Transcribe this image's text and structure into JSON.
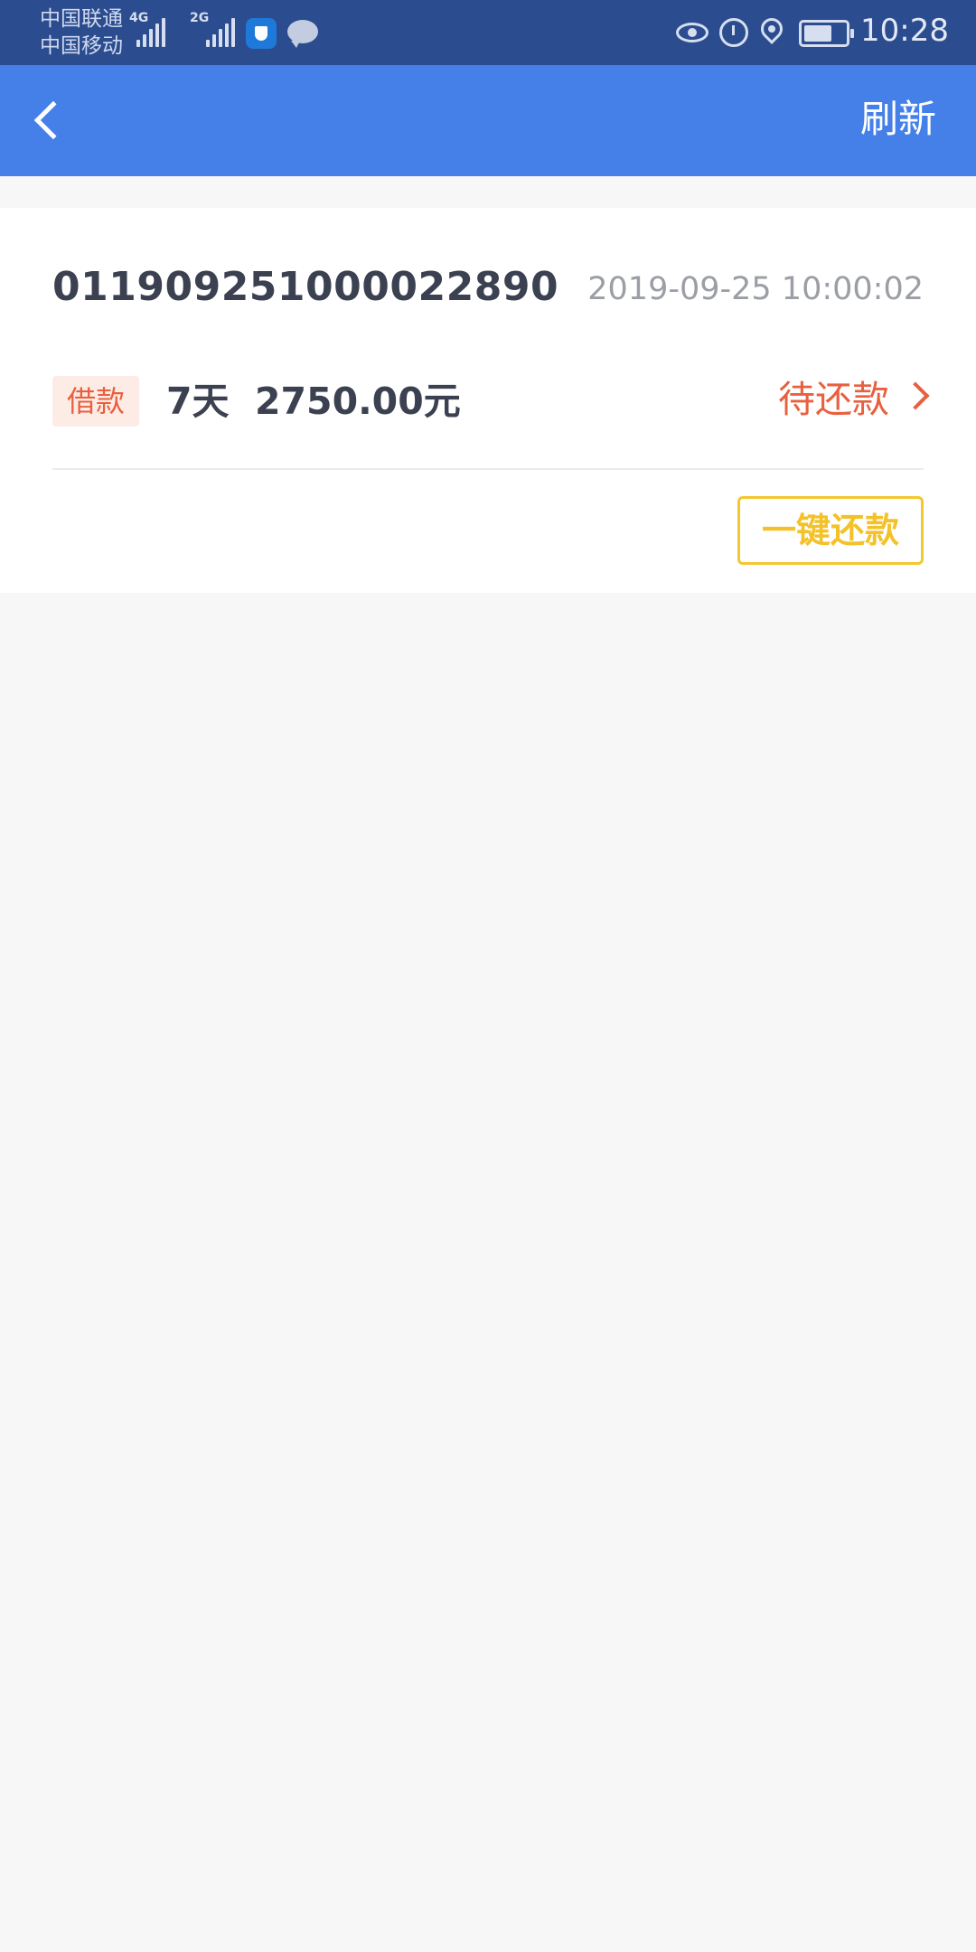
{
  "status_bar": {
    "carrier1": "中国联通",
    "carrier2": "中国移动",
    "net1": "4G",
    "net2": "2G",
    "time": "10:28"
  },
  "nav": {
    "refresh_label": "刷新"
  },
  "order": {
    "number": "011909251000022890",
    "datetime": "2019-09-25 10:00:02",
    "type_badge": "借款",
    "term": "7天",
    "amount": "2750.00元",
    "status": "待还款",
    "repay_button": "一键还款"
  },
  "colors": {
    "status_bar": "#2b4d8f",
    "nav_bar": "#4480e8",
    "accent_orange": "#e8603f",
    "accent_yellow": "#f3c72f",
    "background": "#f7f7f7"
  }
}
